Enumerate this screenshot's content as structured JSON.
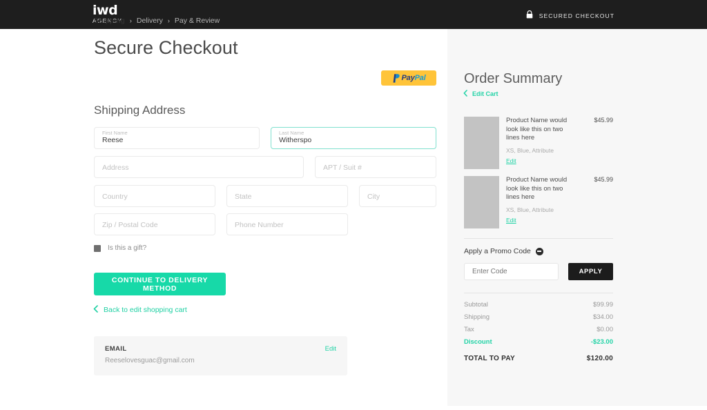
{
  "header": {
    "logo_mark": "iwd",
    "logo_sub": "AGENCY",
    "secured_text": "SECURED CHECKOUT",
    "lock_icon": "lock-icon"
  },
  "breadcrumb": {
    "items": [
      {
        "label": "Shipping",
        "active": true
      },
      {
        "label": "Delivery",
        "active": false
      },
      {
        "label": "Pay & Review",
        "active": false
      }
    ],
    "separator": "›"
  },
  "main": {
    "page_title": "Secure Checkout",
    "paypal": {
      "p1": "Pay",
      "p2": "Pal",
      "icon": "paypal-icon"
    },
    "section_title": "Shipping Address",
    "fields": {
      "first_name": {
        "label": "First Name",
        "value": "Reese"
      },
      "last_name": {
        "label": "Last Name",
        "value": "Witherspo"
      },
      "address": {
        "placeholder": "Address"
      },
      "apt": {
        "placeholder": "APT / Suit #"
      },
      "country": {
        "placeholder": "Country"
      },
      "state": {
        "placeholder": "State"
      },
      "city": {
        "placeholder": "City"
      },
      "zip": {
        "placeholder": "Zip / Postal Code"
      },
      "phone": {
        "placeholder": "Phone Number"
      }
    },
    "gift_label": "Is this a gift?",
    "cta_label": "CONTINUE TO DELIVERY METHOD",
    "back_link": "Back to edit shopping cart",
    "email_card": {
      "title": "EMAIL",
      "value": "Reeselovesguac@gmail.com",
      "edit_label": "Edit"
    }
  },
  "summary": {
    "title": "Order Summary",
    "edit_cart": "Edit Cart",
    "products": [
      {
        "name": "Product Name would look like this on two lines here",
        "price": "$45.99",
        "attributes": "XS, Blue, Attribute",
        "edit_label": "Edit"
      },
      {
        "name": "Product Name would look like this on two lines here",
        "price": "$45.99",
        "attributes": "XS, Blue, Attribute",
        "edit_label": "Edit"
      }
    ],
    "promo": {
      "label": "Apply a Promo Code",
      "input_placeholder": "Enter Code",
      "input_value": "",
      "apply_label": "APPLY"
    },
    "totals": [
      {
        "label": "Subtotal",
        "value": "$99.99"
      },
      {
        "label": "Shipping",
        "value": "$34.00"
      },
      {
        "label": "Tax",
        "value": "$0.00"
      },
      {
        "label": "Discount",
        "value": "-$23.00"
      }
    ],
    "grand_total": {
      "label": "TOTAL TO PAY",
      "value": "$120.00"
    }
  },
  "colors": {
    "accent_teal": "#17d9a8",
    "link_teal": "#22d3a6",
    "header_dark": "#1e1e1e",
    "sidebar_bg": "#f7f7f7",
    "paypal_yellow": "#ffc439"
  }
}
